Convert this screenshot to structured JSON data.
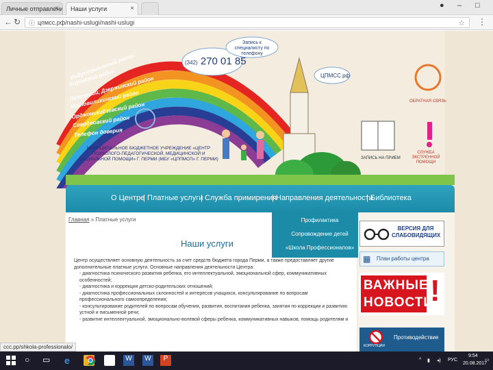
{
  "browser": {
    "tabs": [
      {
        "label": "Личные отправления · П"
      },
      {
        "label": "Наши услуги"
      }
    ],
    "url": "цпмсс.рф/nashi-uslugi/nashi-uslugi",
    "status_url": "ccc.pp/shkola-professionalo/"
  },
  "header": {
    "districts": [
      "Индустриальный район",
      "Кировский район",
      "Ленинский, Дзержинский район",
      "Мотовилихинский район",
      "Орджоникидзевский район",
      "Свердловский район",
      "Телефон доверия"
    ],
    "phone_code": "(342)",
    "phone": "270 01 85",
    "appointment_note": "Запись к специалисту по телефону",
    "site_label": "ЦПМСС.рф",
    "org_name": "МУНИЦИПАЛЬНОЕ БЮДЖЕТНОЕ УЧРЕЖДЕНИЕ «ЦЕНТР ПСИХОЛОГО-ПЕДАГОГИЧЕСКОЙ, МЕДИЦИНСКОЙ И СОЦИАЛЬНОЙ ПОМОЩИ» Г. ПЕРМИ (МБУ «ЦППМСП» Г. ПЕРМИ)",
    "feedback_label": "ОБРАТНАЯ СВЯЗЬ",
    "booking_label": "ЗАПИСЬ НА ПРИЕМ",
    "emergency_label": "СЛУЖБА ЭКСТРЕННОЙ ПОМОЩИ"
  },
  "nav": {
    "items": [
      "О Центре",
      "Платные услуги",
      "Служба примирения",
      "Направления деятельности",
      "Библиотека"
    ],
    "dropdown": [
      "Профилактика",
      "Сопровождение детей",
      "«Школа Профессионалов»"
    ]
  },
  "content": {
    "breadcrumb_home": "Главная",
    "breadcrumb_current": "Платные услуги",
    "title": "Наши услуги",
    "intro": "Центр осуществляет основную деятельность за счет средств бюджета города Перми, а также предоставляет другие дополнительные платные услуги. Основные направления деятельности Центра:",
    "items": [
      "диагностика психического развития ребенка, его интеллектуальной, эмоциональной сфер, коммуникативных особенностей;",
      "диагностика и коррекция детско-родительских отношений;",
      "диагностика профессиональных склонностей и интересов учащихся, консультирование по вопросам профессионального самоопределения;",
      "консультирование родителей по вопросам обучения, развития, воспитания ребенка, занятия по коррекции и развитию устной и письменной речи;",
      "развитие интеллектуальной, эмоционально-волевой сферы ребенка, коммуникативных навыков, помощь родителям и"
    ]
  },
  "sidebar": {
    "vision_label": "ВЕРСИЯ ДЛЯ СЛАБОВИДЯЩИХ",
    "plan_label": "План работы центра",
    "news_label_1": "ВАЖНЫЕ",
    "news_label_2": "НОВОСТИ",
    "corruption_label": "Противодействие",
    "corruption_small": "КОРРУПЦИИ"
  },
  "taskbar": {
    "lang": "РУС",
    "time": "9:54",
    "date": "20.08.2017"
  },
  "colors": {
    "nav_bg": "#1b8ba8",
    "title": "#1b6e96",
    "accent_red": "#d6151f"
  }
}
